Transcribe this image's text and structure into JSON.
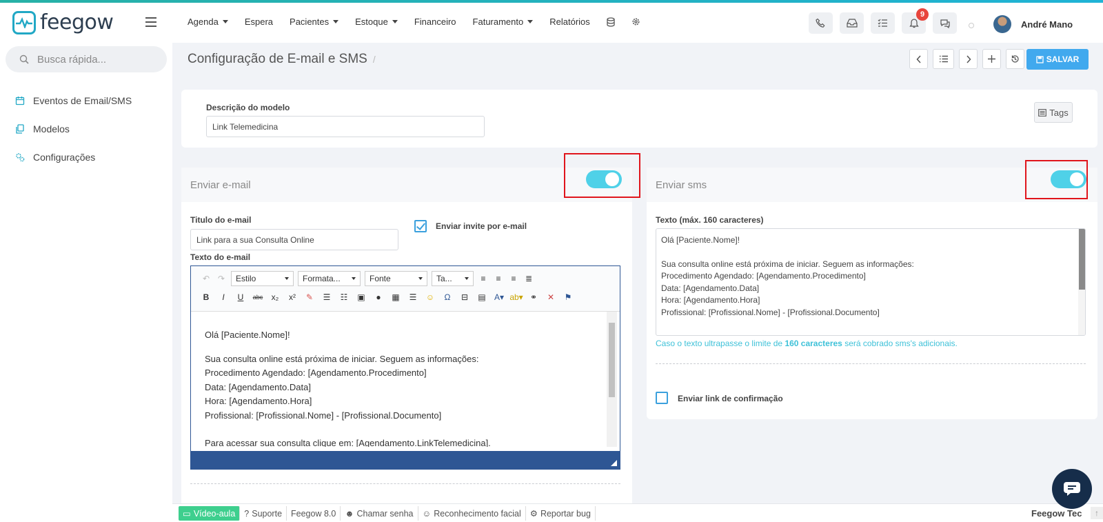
{
  "app": {
    "logo_text": "feegow"
  },
  "nav": {
    "items": [
      {
        "label": "Agenda",
        "dropdown": true
      },
      {
        "label": "Espera",
        "dropdown": false
      },
      {
        "label": "Pacientes",
        "dropdown": true
      },
      {
        "label": "Estoque",
        "dropdown": true
      },
      {
        "label": "Financeiro",
        "dropdown": false
      },
      {
        "label": "Faturamento",
        "dropdown": true
      },
      {
        "label": "Relatórios",
        "dropdown": false
      }
    ],
    "extra_icons": [
      "database-icon",
      "gear-icon"
    ]
  },
  "top_actions": {
    "icons": [
      "phone-icon",
      "inbox-icon",
      "checklist-icon",
      "bell-icon",
      "chat-icon"
    ],
    "notification_count": "9"
  },
  "user": {
    "name": "André Mano"
  },
  "search": {
    "placeholder": "Busca rápida..."
  },
  "sidebar": {
    "items": [
      {
        "label": "Eventos de Email/SMS",
        "icon": "calendar-icon"
      },
      {
        "label": "Modelos",
        "icon": "copy-icon"
      },
      {
        "label": "Configurações",
        "icon": "gears-icon"
      }
    ]
  },
  "page": {
    "title": "Configuração de E-mail e SMS",
    "save_label": "SALVAR"
  },
  "model": {
    "description_label": "Descrição do modelo",
    "description_value": "Link Telemedicina",
    "tags_label": "Tags"
  },
  "email": {
    "header": "Enviar e-mail",
    "enabled": true,
    "title_label": "Titulo do e-mail",
    "title_value": "Link para a sua Consulta Online",
    "invite_label": "Enviar invite por e-mail",
    "invite_checked": true,
    "text_label": "Texto do e-mail",
    "editor": {
      "style_select": "Estilo",
      "format_select": "Formata...",
      "font_select": "Fonte",
      "size_select": "Ta...",
      "lines": [
        "Olá [Paciente.Nome]!",
        "",
        "Sua consulta online está próxima de iniciar. Seguem as informações:",
        "Procedimento Agendado: [Agendamento.Procedimento]",
        "Data: [Agendamento.Data]",
        "Hora: [Agendamento.Hora]",
        "Profissional: [Profissional.Nome] - [Profissional.Documento]",
        "",
        "Para acessar sua consulta clique em: [Agendamento.LinkTelemedicina]."
      ]
    }
  },
  "sms": {
    "header": "Enviar sms",
    "enabled": true,
    "text_label": "Texto (máx. 160 caracteres)",
    "lines": [
      "Olá [Paciente.Nome]!",
      "",
      "Sua consulta online está próxima de iniciar. Seguem as informações:",
      "Procedimento Agendado: [Agendamento.Procedimento]",
      "Data: [Agendamento.Data]",
      "Hora: [Agendamento.Hora]",
      "Profissional: [Profissional.Nome] - [Profissional.Documento]"
    ],
    "hint_prefix": "Caso o texto ultrapasse o limite de ",
    "hint_bold": "160 caracteres",
    "hint_suffix": " será cobrado sms's adicionais.",
    "confirm_label": "Enviar link de confirmação",
    "confirm_checked": false
  },
  "footer": {
    "items": [
      "Vídeo-aula",
      "Suporte",
      "Feegow 8.0",
      "Chamar senha",
      "Reconhecimento facial",
      "Reportar bug"
    ],
    "right_text": "Feegow Tec"
  },
  "colors": {
    "accent": "#41a9ee",
    "toggle": "#4fd1e8",
    "highlight_box": "#e0141b",
    "editor_frame": "#2e5694",
    "hint": "#3ec1d8"
  }
}
